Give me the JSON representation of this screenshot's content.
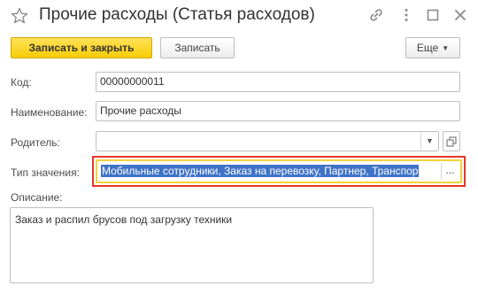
{
  "window": {
    "title": "Прочие расходы (Статья расходов)",
    "icons": [
      "star-icon",
      "link-icon",
      "more-vert-icon",
      "maximize-icon",
      "close-icon"
    ]
  },
  "toolbar": {
    "save_close_label": "Записать и закрыть",
    "save_label": "Записать",
    "more_label": "Еще"
  },
  "form": {
    "code": {
      "label": "Код:",
      "value": "00000000011"
    },
    "name": {
      "label": "Наименование:",
      "value": "Прочие расходы"
    },
    "parent": {
      "label": "Родитель:",
      "value": ""
    },
    "value_type": {
      "label": "Тип значения:",
      "value": "Мобильные сотрудники, Заказ на перевозку, Партнер, Транспор",
      "select_label": "..."
    },
    "description": {
      "label": "Описание:",
      "value": "Заказ и распил брусов под загрузку техники"
    }
  },
  "colors": {
    "primary_button": "#f8cd06",
    "selection": "#3f73c7",
    "focus_frame": "#e8362b",
    "focus_inner": "#f3d33b"
  }
}
